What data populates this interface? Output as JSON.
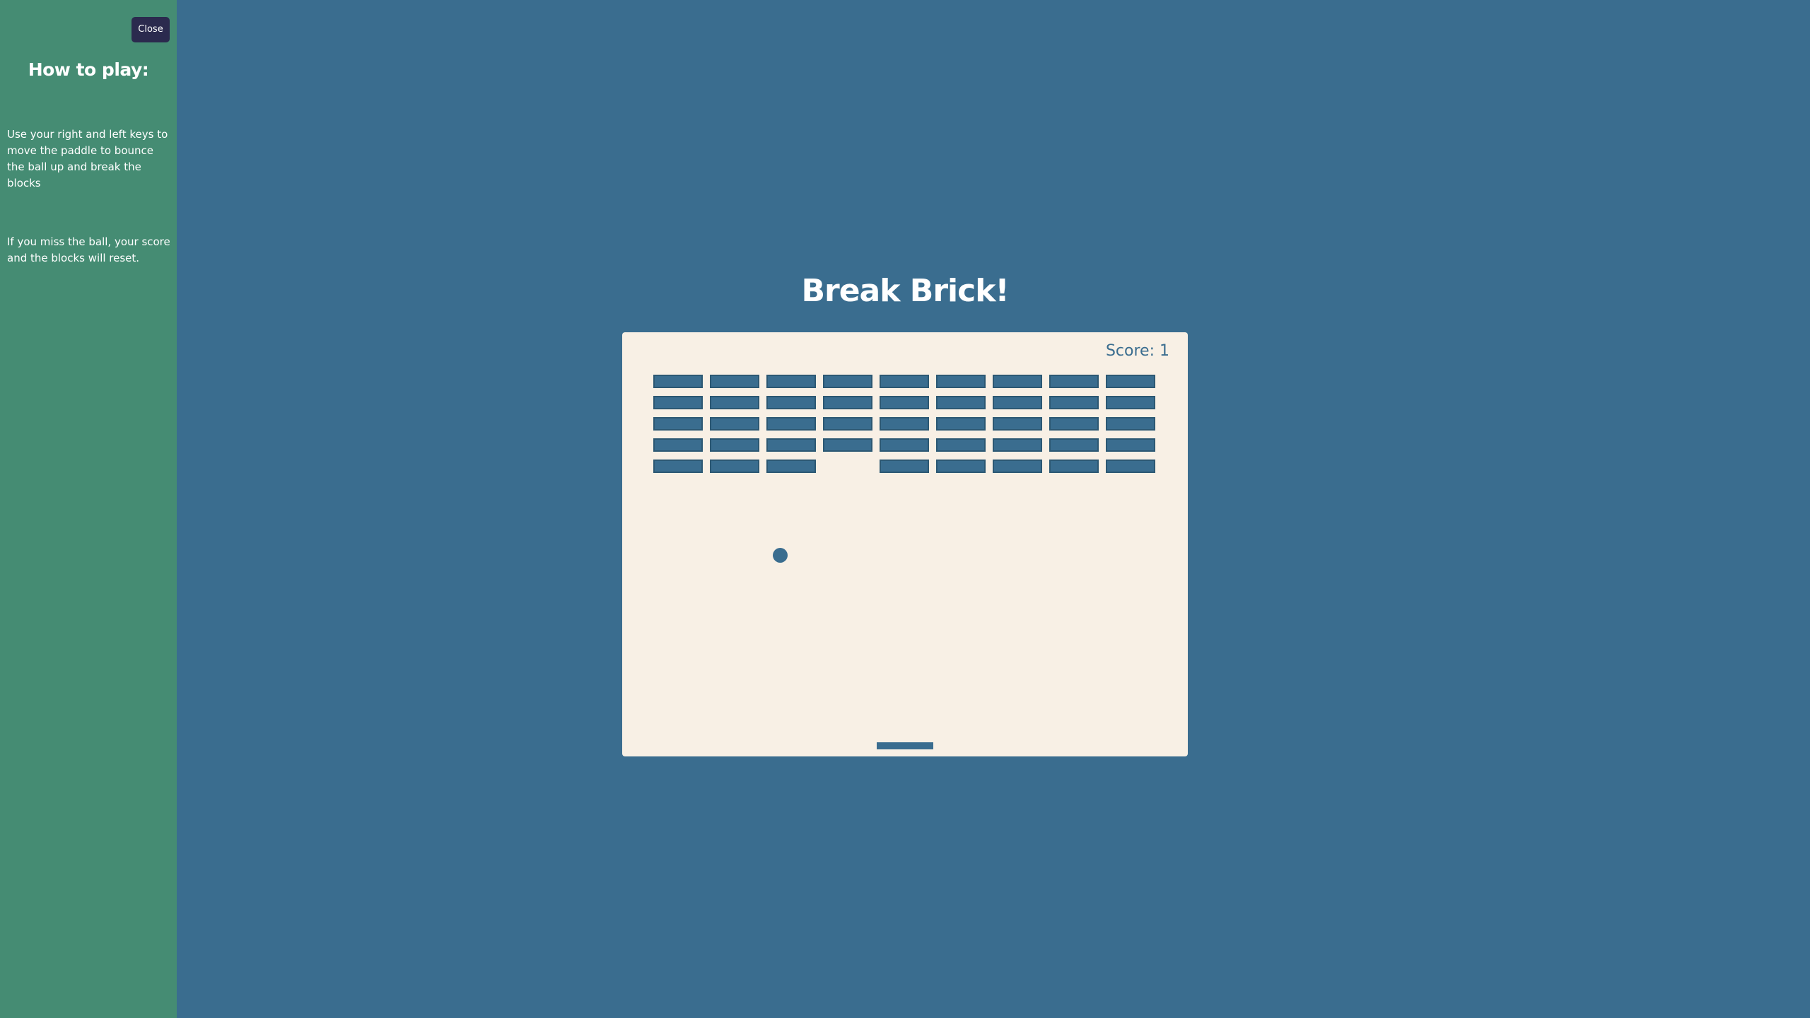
{
  "sidebar": {
    "close_label": "Close",
    "title": "How to play:",
    "paragraphs": [
      "Use your right and left keys to move the paddle to bounce the ball up and break the blocks",
      "If you miss the ball, your score and the blocks will reset."
    ]
  },
  "game": {
    "title": "Break Brick!",
    "score_label": "Score:",
    "score_value": "1",
    "brick_grid": {
      "columns": 9,
      "rows": 5,
      "broken": [
        [
          4,
          3
        ]
      ]
    }
  },
  "colors": {
    "background": "#3a6d8f",
    "sidebar": "#458c73",
    "board": "#f8f0e5",
    "brick": "#3a6d8f",
    "close_button": "#2b2a4e"
  }
}
